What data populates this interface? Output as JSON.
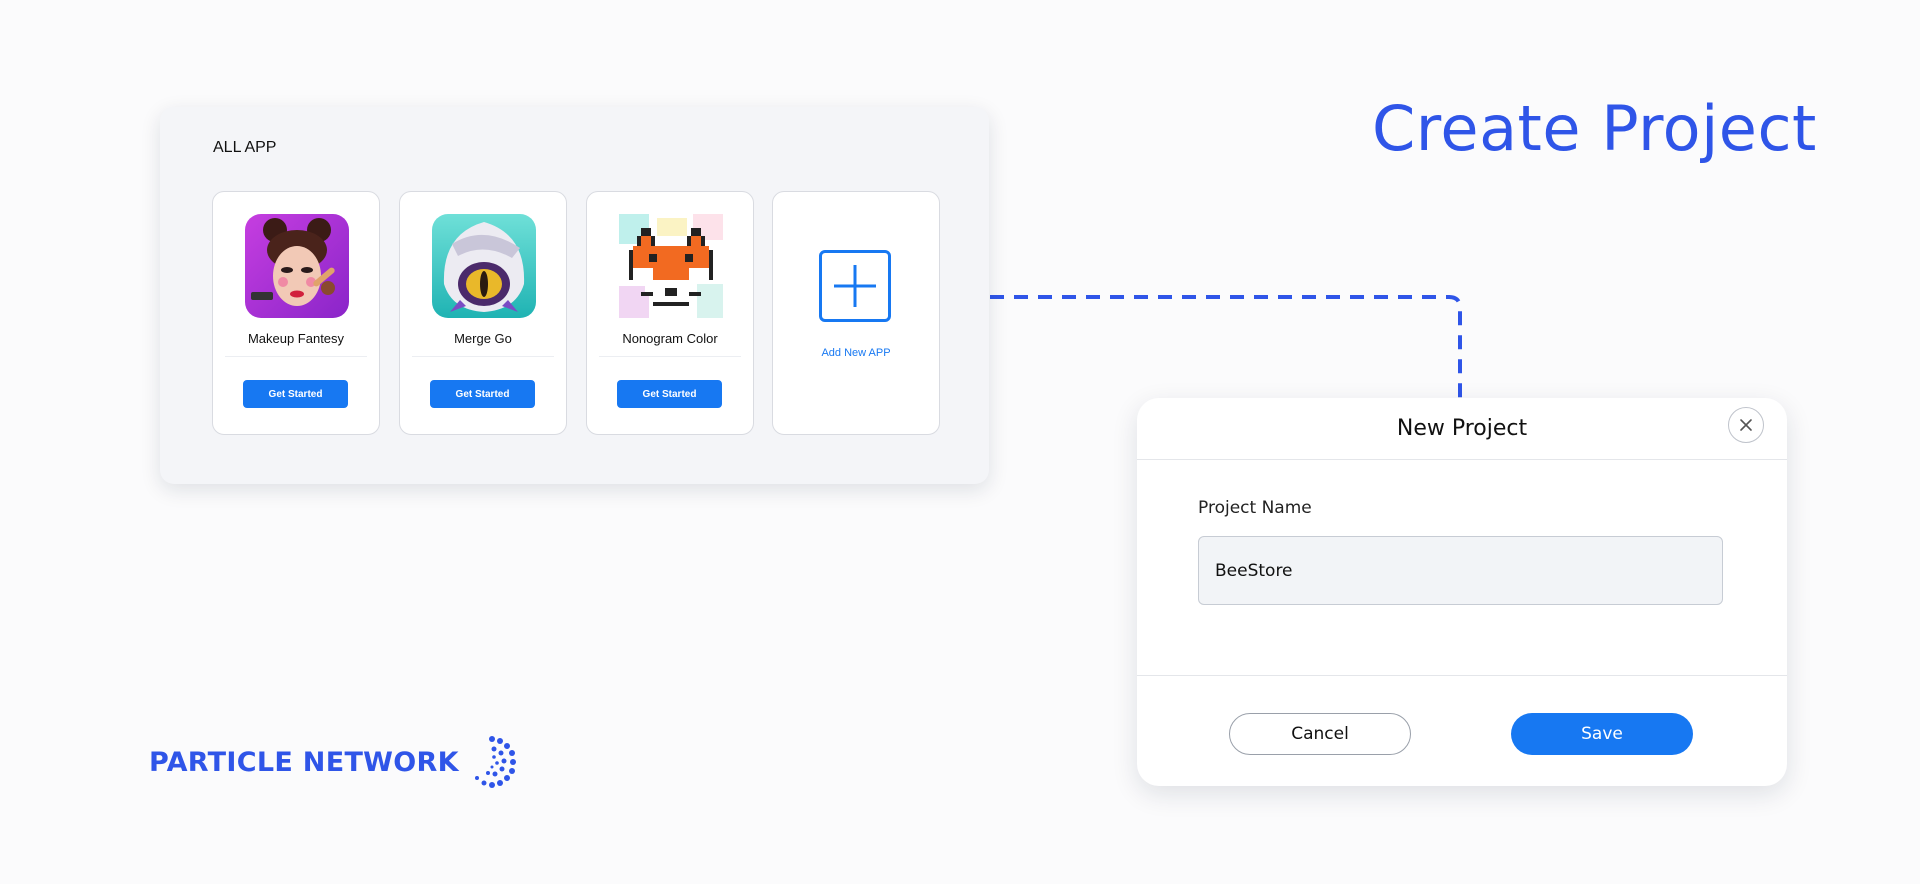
{
  "headline": "Create Project",
  "app_panel": {
    "title": "ALL APP",
    "apps": [
      {
        "name": "Makeup Fantesy",
        "button": "Get Started",
        "icon": "makeup-fantasy-icon"
      },
      {
        "name": "Merge Go",
        "button": "Get Started",
        "icon": "merge-go-icon"
      },
      {
        "name": "Nonogram Color",
        "button": "Get Started",
        "icon": "nonogram-fox-icon"
      }
    ],
    "add_new_label": "Add New APP"
  },
  "dialog": {
    "title": "New Project",
    "field_label": "Project Name",
    "field_value": "BeeStore",
    "cancel_label": "Cancel",
    "save_label": "Save"
  },
  "brand": {
    "name": "PARTICLE NETWORK"
  },
  "colors": {
    "accent": "#2f55e8",
    "button_blue": "#1778f2",
    "background": "#fbfbfc",
    "panel": "#f4f5f8"
  }
}
